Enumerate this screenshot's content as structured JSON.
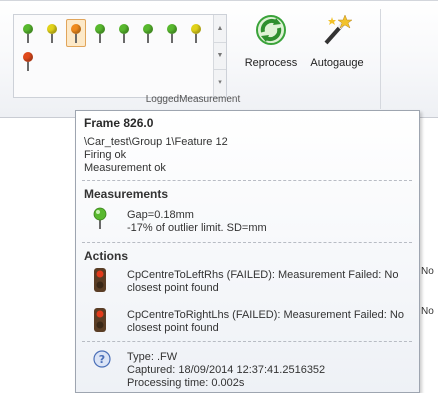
{
  "ribbon": {
    "pins": [
      {
        "color": "#58b82e",
        "selected": false
      },
      {
        "color": "#e1d21a",
        "selected": false
      },
      {
        "color": "#f08a1c",
        "selected": true
      },
      {
        "color": "#58b82e",
        "selected": false
      },
      {
        "color": "#58b82e",
        "selected": false
      },
      {
        "color": "#58b82e",
        "selected": false
      },
      {
        "color": "#58b82e",
        "selected": false
      },
      {
        "color": "#e1d21a",
        "selected": false
      },
      {
        "color": "#e04a1c",
        "selected": false
      }
    ],
    "reprocess_label": "Reprocess",
    "autogauge_label": "Autogauge",
    "group_label": "LoggedMeasurement"
  },
  "tooltip": {
    "title": "Frame 826.0",
    "path": "\\Car_test\\Group 1\\Feature 12",
    "firing": "Firing ok",
    "measurement_status": "Measurement ok",
    "measurements_heading": "Measurements",
    "gap_line1": "Gap=0.18mm",
    "gap_line2": "-17% of outlier limit. SD=mm",
    "actions_heading": "Actions",
    "action1_line1": "CpCentreToLeftRhs (FAILED): Measurement Failed: No",
    "action1_line2": "closest point found",
    "action2_line1": "CpCentreToRightLhs (FAILED): Measurement Failed: No",
    "action2_line2": "closest point found",
    "type_line": "Type: .FW",
    "captured_line": "Captured: 18/09/2014 12:37:41.2516352",
    "processing_line": "Processing time: 0.002s"
  },
  "background": {
    "no_label_1": "No",
    "no_label_2": "No"
  },
  "colors": {
    "recycle": "#3aa33a",
    "traffic_light_body": "#5a3d25",
    "lamp_red": "#e23b1c",
    "info_icon": "#4a6fb8"
  }
}
